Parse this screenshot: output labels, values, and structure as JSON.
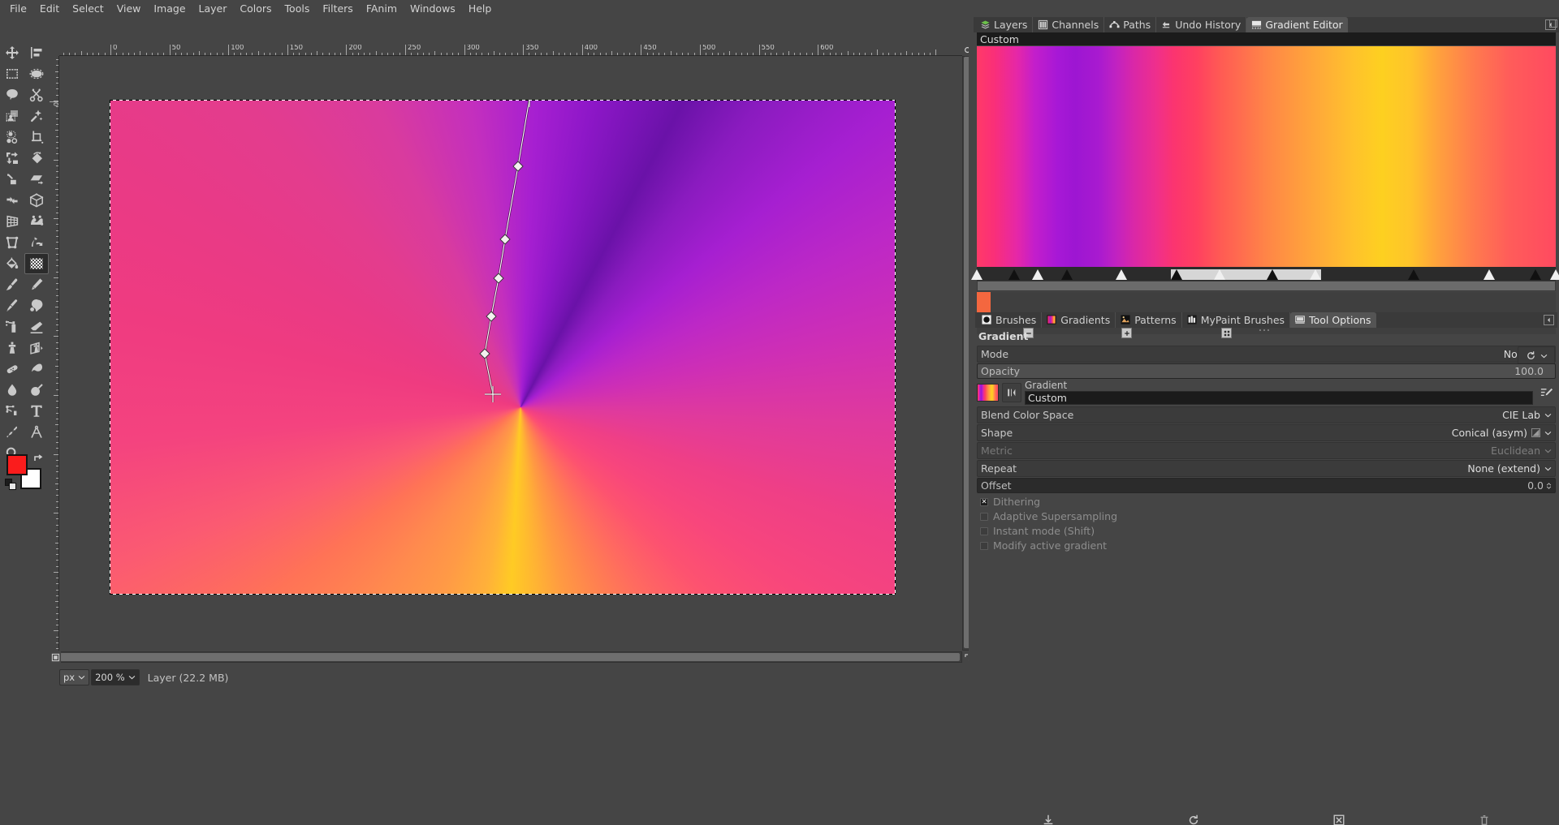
{
  "app": {
    "title": "GIMP",
    "menu": [
      "File",
      "Edit",
      "Select",
      "View",
      "Image",
      "Layer",
      "Colors",
      "Tools",
      "Filters",
      "FAnim",
      "Windows",
      "Help"
    ]
  },
  "toolbox": {
    "tools": [
      {
        "name": "move-tool",
        "icon": "move"
      },
      {
        "name": "alignment-tool",
        "icon": "align"
      },
      {
        "name": "rectangle-select-tool",
        "icon": "rect-select"
      },
      {
        "name": "ellipse-select-tool",
        "icon": "ellipse-select"
      },
      {
        "name": "free-select-tool",
        "icon": "lasso"
      },
      {
        "name": "scissors-select-tool",
        "icon": "scissors"
      },
      {
        "name": "foreground-select-tool",
        "icon": "fg-select"
      },
      {
        "name": "fuzzy-select-tool",
        "icon": "magic-wand"
      },
      {
        "name": "select-by-color-tool",
        "icon": "by-color"
      },
      {
        "name": "crop-tool",
        "icon": "crop"
      },
      {
        "name": "unified-transform-tool",
        "icon": "unified-transform"
      },
      {
        "name": "rotate-tool",
        "icon": "rotate"
      },
      {
        "name": "scale-tool",
        "icon": "scale"
      },
      {
        "name": "shear-tool",
        "icon": "shear"
      },
      {
        "name": "flip-tool",
        "icon": "flip"
      },
      {
        "name": "3d-transform-tool",
        "icon": "cube"
      },
      {
        "name": "perspective-tool",
        "icon": "perspective"
      },
      {
        "name": "warp-transform-tool",
        "icon": "warp"
      },
      {
        "name": "handle-transform-tool",
        "icon": "handle-transform"
      },
      {
        "name": "cage-transform-tool",
        "icon": "cage"
      },
      {
        "name": "bucket-fill-tool",
        "icon": "bucket"
      },
      {
        "name": "gradient-tool",
        "icon": "gradient",
        "selected": true
      },
      {
        "name": "paintbrush-tool",
        "icon": "paintbrush"
      },
      {
        "name": "pencil-tool",
        "icon": "pencil"
      },
      {
        "name": "ink-tool",
        "icon": "ink"
      },
      {
        "name": "mypaint-brush-tool",
        "icon": "mypaint"
      },
      {
        "name": "airbrush-tool",
        "icon": "airbrush"
      },
      {
        "name": "eraser-tool",
        "icon": "eraser"
      },
      {
        "name": "clone-tool",
        "icon": "clone"
      },
      {
        "name": "perspective-clone-tool",
        "icon": "perspective-clone"
      },
      {
        "name": "heal-tool",
        "icon": "heal"
      },
      {
        "name": "smudge-tool",
        "icon": "smudge"
      },
      {
        "name": "blur-sharpen-tool",
        "icon": "blur"
      },
      {
        "name": "dodge-burn-tool",
        "icon": "dodge"
      },
      {
        "name": "paths-tool",
        "icon": "path"
      },
      {
        "name": "text-tool",
        "icon": "text"
      },
      {
        "name": "color-picker-tool",
        "icon": "eyedropper"
      },
      {
        "name": "measure-tool",
        "icon": "measure"
      },
      {
        "name": "zoom-tool",
        "icon": "magnifier"
      }
    ],
    "foreground_color": "#fa1c1c",
    "background_color": "#ffffff"
  },
  "image_tabs": [
    {
      "name": "image-thumb-1",
      "selected": false
    },
    {
      "name": "image-thumb-2",
      "selected": true
    }
  ],
  "canvas": {
    "hruler_labels": [
      "0",
      "50",
      "100",
      "150",
      "200",
      "250",
      "300",
      "350",
      "400",
      "450",
      "500",
      "550",
      "600"
    ],
    "vruler_labels": [
      "0"
    ],
    "unit": "px",
    "zoom": "200 %",
    "status": "Layer (22.2 MB)",
    "gradient_handles": 7
  },
  "dock": {
    "top_tabs": [
      {
        "label": "Layers",
        "icon": "layers-icon",
        "active": false
      },
      {
        "label": "Channels",
        "icon": "channels-icon",
        "active": false
      },
      {
        "label": "Paths",
        "icon": "paths-icon",
        "active": false
      },
      {
        "label": "Undo History",
        "icon": "undo-history-icon",
        "active": false
      },
      {
        "label": "Gradient Editor",
        "icon": "gradient-editor-icon",
        "active": true
      }
    ],
    "bottom_tabs": [
      {
        "label": "Brushes",
        "icon": "brushes-icon",
        "active": false
      },
      {
        "label": "Gradients",
        "icon": "gradients-icon",
        "active": false
      },
      {
        "label": "Patterns",
        "icon": "patterns-icon",
        "active": false
      },
      {
        "label": "MyPaint Brushes",
        "icon": "mypaint-brushes-icon",
        "active": false
      },
      {
        "label": "Tool Options",
        "icon": "tool-options-icon",
        "active": true
      }
    ]
  },
  "gradient_editor": {
    "name": "Custom",
    "selected_color": "#f4673f",
    "stops": [
      {
        "pos": 0.0,
        "type": "endpoint"
      },
      {
        "pos": 0.065,
        "type": "mid"
      },
      {
        "pos": 0.105,
        "type": "stop"
      },
      {
        "pos": 0.155,
        "type": "mid"
      },
      {
        "pos": 0.25,
        "type": "stop"
      },
      {
        "pos": 0.345,
        "type": "mid"
      },
      {
        "pos": 0.42,
        "type": "stop"
      },
      {
        "pos": 0.51,
        "type": "mid"
      },
      {
        "pos": 0.585,
        "type": "stop"
      },
      {
        "pos": 0.755,
        "type": "mid"
      },
      {
        "pos": 0.885,
        "type": "stop"
      },
      {
        "pos": 0.965,
        "type": "mid"
      },
      {
        "pos": 1.0,
        "type": "endpoint"
      }
    ],
    "buttons": [
      "zoom-out-button",
      "zoom-in-button",
      "zoom-fit-button"
    ]
  },
  "tool_options": {
    "title": "Gradient",
    "mode": {
      "label": "Mode",
      "value": "Normal"
    },
    "opacity": {
      "label": "Opacity",
      "value": "100.0",
      "fill_pct": 100
    },
    "gradient": {
      "label": "Gradient",
      "value": "Custom"
    },
    "blend_color_space": {
      "label": "Blend Color Space",
      "value": "CIE Lab"
    },
    "shape": {
      "label": "Shape",
      "value": "Conical (asym)"
    },
    "metric": {
      "label": "Metric",
      "value": "Euclidean",
      "disabled": true
    },
    "repeat": {
      "label": "Repeat",
      "value": "None (extend)"
    },
    "offset": {
      "label": "Offset",
      "value": "0.0",
      "fill_pct": 0
    },
    "checkboxes": [
      {
        "label": "Dithering",
        "checked": true
      },
      {
        "label": "Adaptive Supersampling",
        "checked": false
      },
      {
        "label": "Instant mode  (Shift)",
        "checked": false
      },
      {
        "label": "Modify active gradient",
        "checked": false
      }
    ],
    "footer_buttons": [
      "save-tool-preset-button",
      "restore-tool-preset-button",
      "reset-tool-options-button",
      "delete-tool-preset-button"
    ]
  },
  "colors": {
    "panel_bg": "#454545",
    "dark_bg": "#2b2b2b",
    "text": "#c8c8c8",
    "accent_selected": "#545454"
  }
}
